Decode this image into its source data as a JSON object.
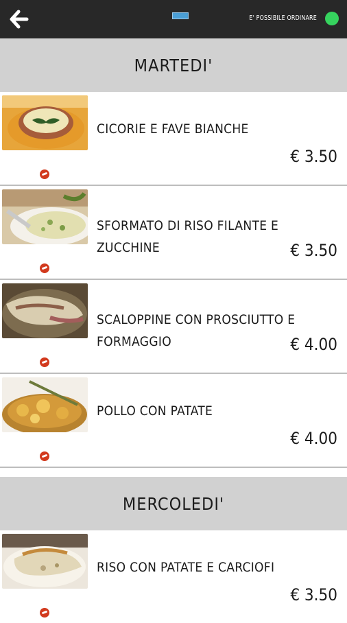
{
  "header": {
    "status_text": "E' POSSIBILE ORDINARE",
    "status_color": "#36d35e"
  },
  "days": [
    {
      "label": "MARTEDI'",
      "items": [
        {
          "name": "CICORIE E FAVE BIANCHE",
          "price": "€ 3.50",
          "photo": "soup-icon"
        },
        {
          "name": "SFORMATO DI RISO FILANTE E ZUCCHINE",
          "price": "€ 3.50",
          "photo": "rice-dish-icon"
        },
        {
          "name": "SCALOPPINE CON PROSCIUTTO E FORMAGGIO",
          "price": "€ 4.00",
          "photo": "scaloppine-icon"
        },
        {
          "name": "POLLO CON PATATE",
          "price": "€ 4.00",
          "photo": "chicken-icon"
        }
      ]
    },
    {
      "label": "MERCOLEDI'",
      "items": [
        {
          "name": "RISO CON PATATE E CARCIOFI",
          "price": "€ 3.50",
          "photo": "rice-potato-icon"
        }
      ]
    }
  ]
}
